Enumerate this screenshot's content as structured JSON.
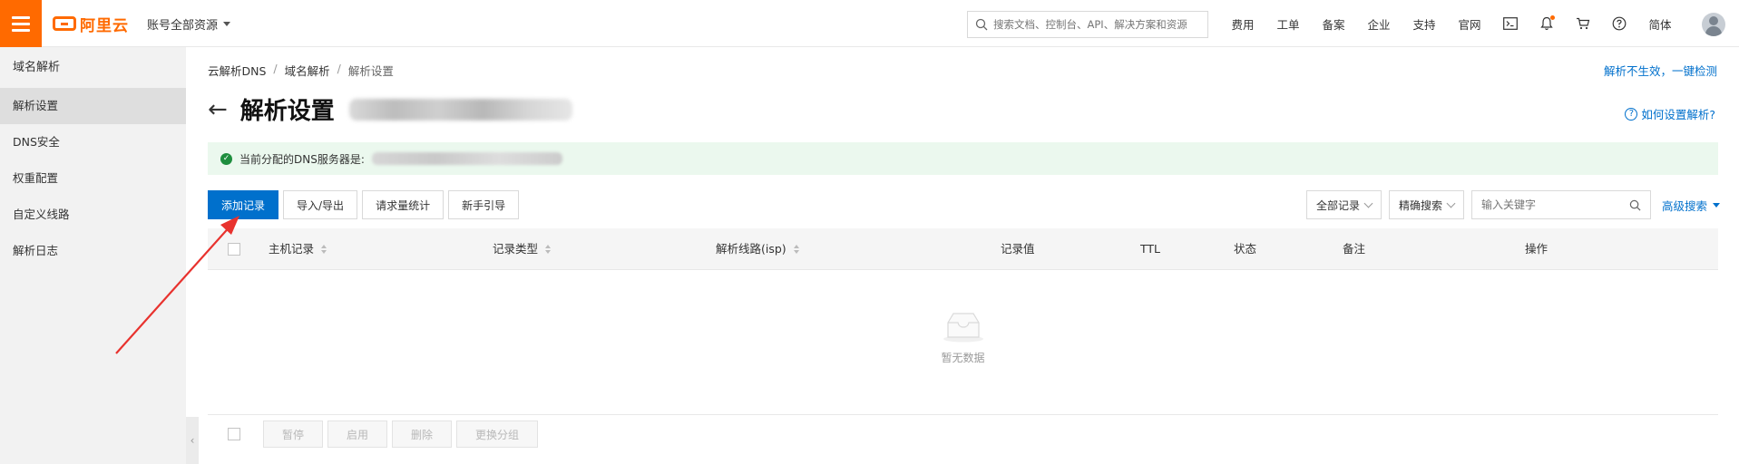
{
  "header": {
    "logo_text": "阿里云",
    "account_switch": "账号全部资源",
    "search_placeholder": "搜索文档、控制台、API、解决方案和资源",
    "nav_links": [
      "费用",
      "工单",
      "备案",
      "企业",
      "支持",
      "官网"
    ],
    "language": "简体",
    "icons": [
      "terminal-icon",
      "bell-icon",
      "cart-icon",
      "help-icon"
    ],
    "accent_color": "#ff6a00"
  },
  "sidebar": {
    "title": "域名解析",
    "items": [
      {
        "label": "解析设置",
        "active": true
      },
      {
        "label": "DNS安全",
        "active": false
      },
      {
        "label": "权重配置",
        "active": false
      },
      {
        "label": "自定义线路",
        "active": false
      },
      {
        "label": "解析日志",
        "active": false
      }
    ]
  },
  "breadcrumb": [
    "云解析DNS",
    "域名解析",
    "解析设置"
  ],
  "breadcrumb_sep": "/",
  "top_right_link": "解析不生效，一键检测",
  "page_title": "解析设置",
  "help_link": "如何设置解析?",
  "notice": {
    "text": "当前分配的DNS服务器是:"
  },
  "toolbar": {
    "add_record": "添加记录",
    "import_export": "导入/导出",
    "request_stats": "请求量统计",
    "beginner_guide": "新手引导"
  },
  "filters": {
    "record_scope": "全部记录",
    "search_mode": "精确搜索",
    "keyword_placeholder": "输入关键字",
    "advanced_search": "高级搜索"
  },
  "table": {
    "columns": [
      "主机记录",
      "记录类型",
      "解析线路(isp)",
      "记录值",
      "TTL",
      "状态",
      "备注",
      "操作"
    ],
    "empty_text": "暂无数据"
  },
  "bulk_actions": [
    "暂停",
    "启用",
    "删除",
    "更换分组"
  ],
  "primary_color": "#0070cc"
}
